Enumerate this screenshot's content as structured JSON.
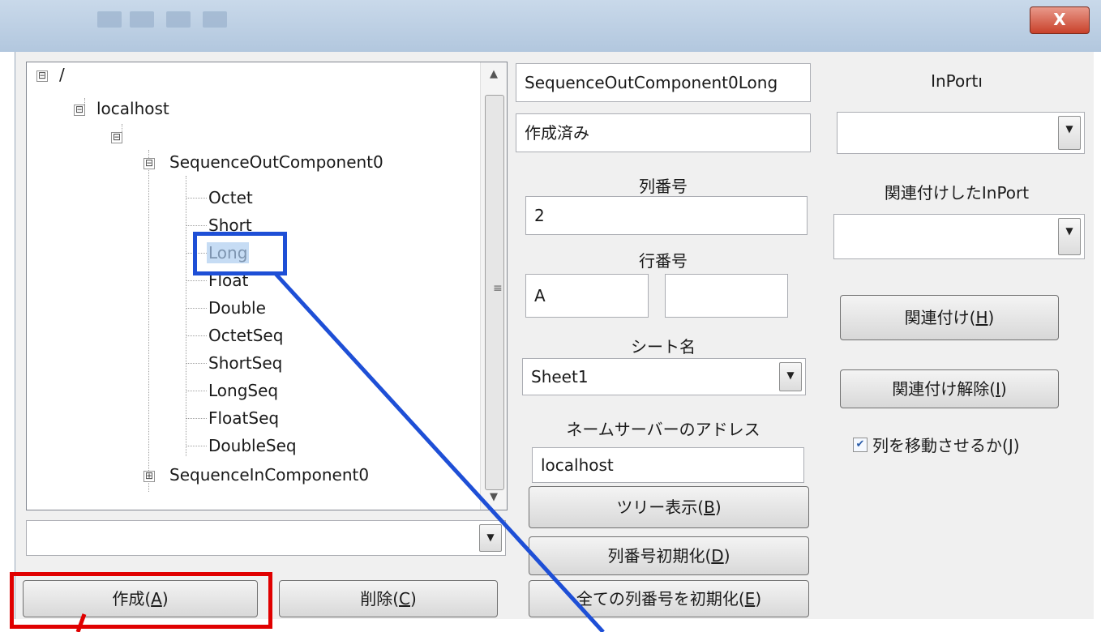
{
  "window": {
    "close_label": "X"
  },
  "tree": {
    "nodes": [
      {
        "label": "/",
        "expander": "⊟"
      },
      {
        "label": "localhost",
        "expander": "⊟"
      },
      {
        "label": "",
        "expander": "⊟"
      },
      {
        "label": "SequenceOutComponent0",
        "expander": "⊟"
      },
      {
        "label": "Octet"
      },
      {
        "label": "Short"
      },
      {
        "label": "Long"
      },
      {
        "label": "Float"
      },
      {
        "label": "Double"
      },
      {
        "label": "OctetSeq"
      },
      {
        "label": "ShortSeq"
      },
      {
        "label": "LongSeq"
      },
      {
        "label": "FloatSeq"
      },
      {
        "label": "DoubleSeq"
      },
      {
        "label": "SequenceInComponent0",
        "expander": "⊞"
      }
    ],
    "selected": "Long"
  },
  "left_combo": {
    "value": ""
  },
  "buttons": {
    "create": {
      "text": "作成(",
      "key": "A",
      "close": ")"
    },
    "delete": {
      "text": "削除(",
      "key": "C",
      "close": ")"
    },
    "tree_view": {
      "text": "ツリー表示(",
      "key": "B",
      "close": ")"
    },
    "init_col": {
      "text": "列番号初期化(",
      "key": "D",
      "close": ")"
    },
    "init_all": {
      "text": "全ての列番号を初期化(",
      "key": "E",
      "close": ")"
    },
    "link": {
      "text": "関連付け(",
      "key": "H",
      "close": ")"
    },
    "unlink": {
      "text": "関連付け解除(",
      "key": "I",
      "close": ")"
    }
  },
  "middle": {
    "component_name": "SequenceOutComponent0Long",
    "status": "作成済み",
    "col_label": "列番号",
    "col_value": "2",
    "row_label": "行番号",
    "row_value": "A",
    "row_value2": "",
    "sheet_label": "シート名",
    "sheet_value": "Sheet1",
    "ns_label": "ネームサーバーのアドレス",
    "ns_value": "localhost"
  },
  "right": {
    "inport_label": "InPortı",
    "inport_value": "",
    "linked_label": "関連付けしたInPort",
    "linked_value": "",
    "move_col": {
      "text": "列を移動させるか(",
      "key": "J",
      "close": ")",
      "checked": true
    }
  },
  "colors": {
    "highlight_red": "#e00000",
    "highlight_blue": "#1e4fd6",
    "selection": "#c6dcf4"
  }
}
